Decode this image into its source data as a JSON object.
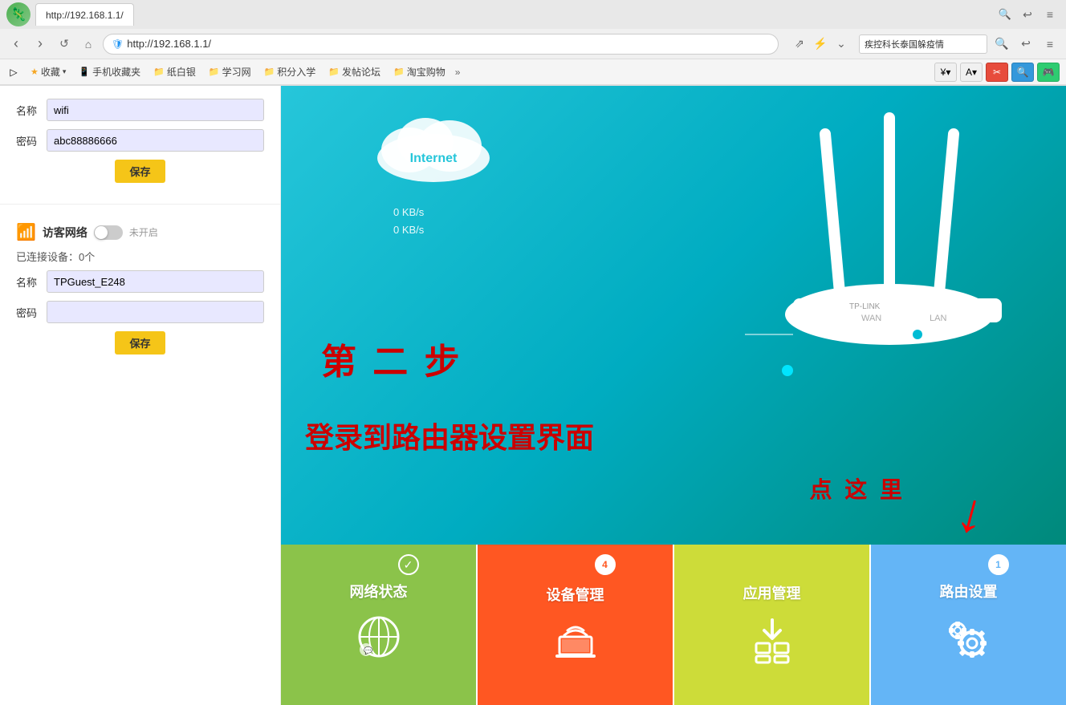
{
  "browser": {
    "tab_title": "192.168.1.1",
    "address": "http://192.168.1.1/",
    "search_hint": "疾控科长泰国躲疫情",
    "nav_back": "‹",
    "nav_forward": "›",
    "nav_refresh": "↺",
    "nav_home": "⌂",
    "bookmarks": [
      {
        "label": "收藏",
        "icon": "★"
      },
      {
        "label": "手机收藏夹",
        "icon": "📱"
      },
      {
        "label": "纸白银",
        "icon": "📁"
      },
      {
        "label": "学习网",
        "icon": "📁"
      },
      {
        "label": "积分入学",
        "icon": "📁"
      },
      {
        "label": "发帖论坛",
        "icon": "📁"
      },
      {
        "label": "淘宝购物",
        "icon": "📁"
      }
    ]
  },
  "sidebar": {
    "wifi_section": {
      "name_label": "名称",
      "name_value": "wifi",
      "password_label": "密码",
      "password_value": "abc88886666",
      "save_btn": "保存"
    },
    "guest_section": {
      "title": "访客网络",
      "toggle_state": "未开启",
      "connected_label": "已连接设备：0个",
      "name_label": "名称",
      "name_value": "TPGuest_E248",
      "password_label": "密码",
      "password_value": "",
      "save_btn": "保存"
    }
  },
  "router_area": {
    "speed1": "0 KB/s",
    "speed2": "0 KB/s",
    "cloud_label": "Internet",
    "step_text": "第 二 步",
    "login_text": "登录到路由器设置界面",
    "click_here": "点 这 里"
  },
  "bottom_nav": {
    "tiles": [
      {
        "id": "network-status",
        "label": "网络状态",
        "badge": "✓",
        "badge_type": "check",
        "color": "tile-green",
        "icon": "🌐"
      },
      {
        "id": "device-manage",
        "label": "设备管理",
        "badge": "4",
        "badge_type": "number",
        "color": "tile-orange",
        "icon": "💻"
      },
      {
        "id": "app-manage",
        "label": "应用管理",
        "badge": "",
        "badge_type": "none",
        "color": "tile-lime",
        "icon": "⊞"
      },
      {
        "id": "router-settings",
        "label": "路由设置",
        "badge": "1",
        "badge_type": "number-blue",
        "color": "tile-blue",
        "icon": "⚙"
      }
    ]
  }
}
